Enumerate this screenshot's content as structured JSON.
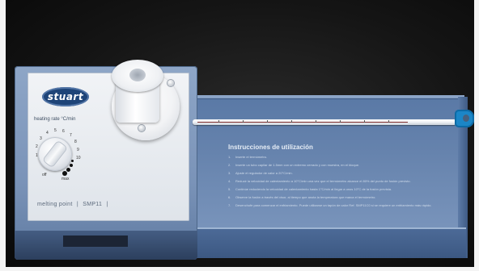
{
  "device": {
    "brand": "stuart",
    "heating_label": "heating rate °C/min",
    "dial_numbers": [
      "1",
      "2",
      "3",
      "4",
      "5",
      "6",
      "7",
      "8",
      "9",
      "10"
    ],
    "dial_off": "off",
    "dial_max": "max",
    "product_name": "melting point",
    "model": "SMP11",
    "accent_color": "#1e4478",
    "housing_color": "#7a93b8"
  },
  "instructions": {
    "title": "Instrucciones de utilización",
    "steps": [
      "Inserte el termómetro.",
      "Inserte un tubo capilar de 1.5mm con un extremo cerrado y con muestra, en el bloque.",
      "Ajuste el regulador de calor a 20°C/min.",
      "Reducir la velocidad de calentamiento a 10°C/min una vez que el termómetro alcance el 80% del punto de fusión previsto.",
      "Continúe reduciendo la velocidad de calentamiento hasta 1°C/min al llegar a unos 10°C de la fusión prevista.",
      "Observe la fusión a través del visor, al tiempo que anota la temperatura que marca el termómetro.",
      "Desenchufe para comenzar el enfriamiento. Puede utilizarse un tapón de calor Ref. SMP11C0 si se requiere un enfriamiento más rápido."
    ]
  },
  "thermometer": {
    "clip_color": "#1b86c7"
  }
}
